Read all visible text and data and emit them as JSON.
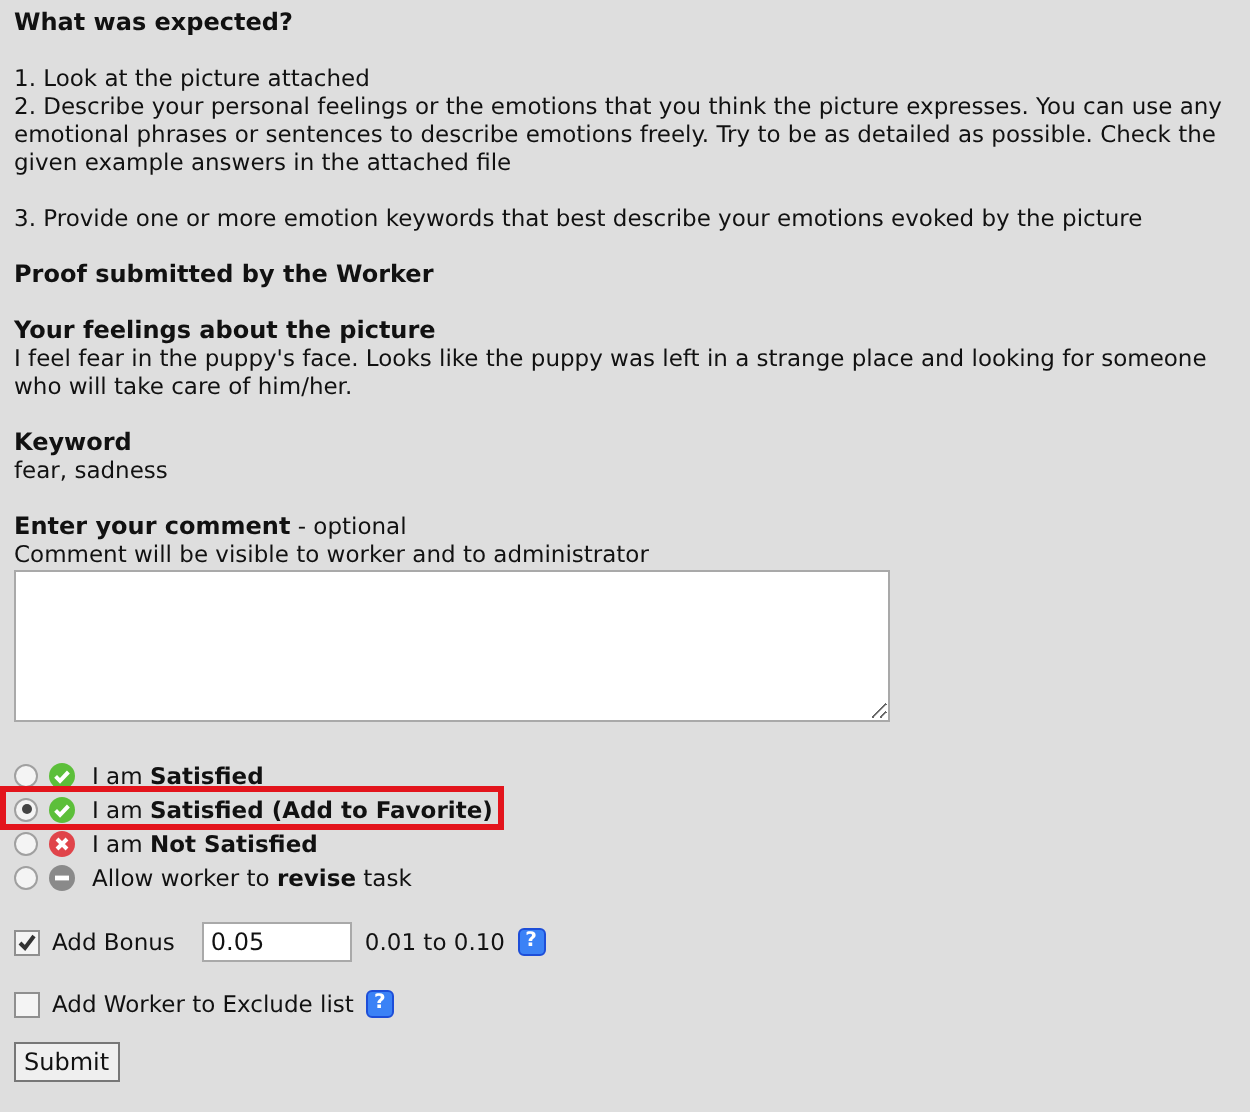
{
  "expected": {
    "heading": "What was expected?",
    "steps": [
      "1. Look at the picture attached",
      "2. Describe your personal feelings or the emotions that you think the picture expresses. You can use any emotional phrases or sentences to describe emotions freely. Try to be as detailed as possible. Check the given example answers in the attached file",
      "3. Provide one or more emotion keywords that best describe your emotions evoked by the picture"
    ]
  },
  "proof": {
    "heading": "Proof submitted by the Worker",
    "fields": [
      {
        "label": "Your feelings about the picture",
        "value": "I feel fear in the puppy's face. Looks like the puppy was left in a strange place and looking for someone who will take care of him/her."
      },
      {
        "label": "Keyword",
        "value": "fear, sadness"
      }
    ]
  },
  "comment": {
    "label": "Enter your comment",
    "optional": " - optional",
    "hint": "Comment will be visible to worker and to administrator"
  },
  "options": [
    {
      "kind": "ok",
      "text": "I am **Satisfied**",
      "selected": false,
      "highlighted": false
    },
    {
      "kind": "ok",
      "text": "I am **Satisfied (Add to Favorite)**",
      "selected": true,
      "highlighted": true
    },
    {
      "kind": "no",
      "text": "I am **Not Satisfied**",
      "selected": false,
      "highlighted": false
    },
    {
      "kind": "revise",
      "text": "Allow worker to **revise** task",
      "selected": false,
      "highlighted": false
    }
  ],
  "bonus": {
    "label": "Add Bonus",
    "checked": true,
    "value": "0.05",
    "range": "0.01 to 0.10",
    "help": "?"
  },
  "exclude": {
    "label": "Add Worker to Exclude list",
    "checked": false,
    "help": "?"
  },
  "submit": "Submit"
}
